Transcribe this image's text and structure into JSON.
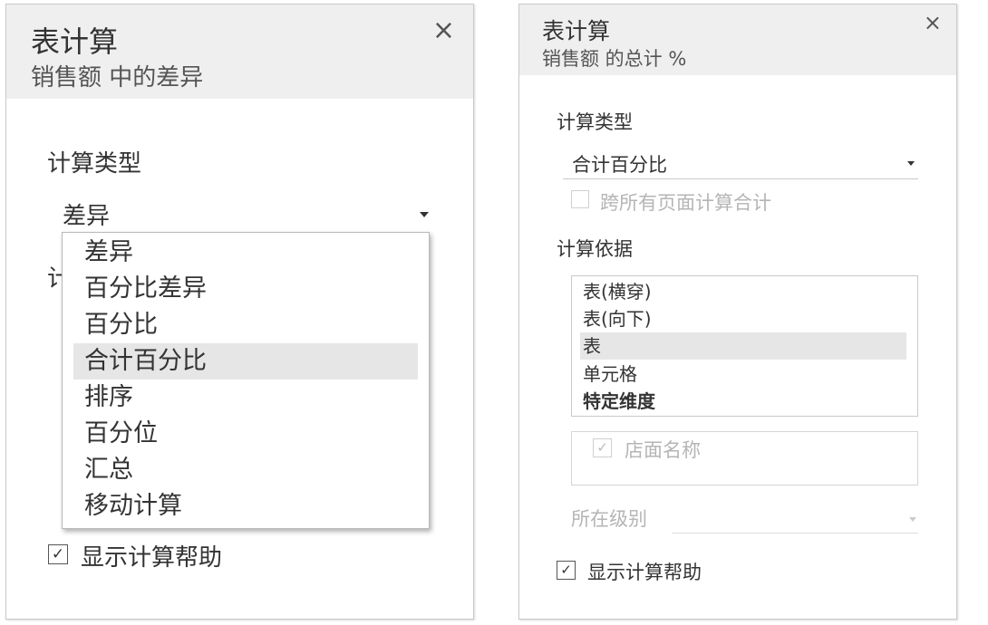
{
  "left_panel": {
    "title": "表计算",
    "subtitle": "销售额 中的差异",
    "close_glyph": "×",
    "calc_type_label": "计算类型",
    "calc_type_value": "差异",
    "hidden_label_fragment": "计",
    "dropdown_options": [
      "差异",
      "百分比差异",
      "百分比",
      "合计百分比",
      "排序",
      "百分位",
      "汇总",
      "移动计算"
    ],
    "dropdown_highlighted": "合计百分比",
    "show_help_checked": "✓",
    "show_help_label": "显示计算帮助"
  },
  "right_panel": {
    "title": "表计算",
    "subtitle": "销售额 的总计 %",
    "close_glyph": "×",
    "calc_type_label": "计算类型",
    "calc_type_value": "合计百分比",
    "cross_pages_label": "跨所有页面计算合计",
    "compute_using_label": "计算依据",
    "compute_using_options": [
      "表(横穿)",
      "表(向下)",
      "表",
      "单元格",
      "特定维度"
    ],
    "compute_using_selected": "表",
    "dimension_checked": "✓",
    "dimension_item": "店面名称",
    "level_label": "所在级别",
    "show_help_checked": "✓",
    "show_help_label": "显示计算帮助"
  },
  "colors": {
    "header_bg": "#efefef",
    "selected_bg": "#e6e6e6",
    "text": "#333333",
    "disabled_text": "#b5b5b5"
  },
  "icons": [
    "close-icon",
    "dropdown-arrow-icon",
    "checkbox-icon"
  ]
}
